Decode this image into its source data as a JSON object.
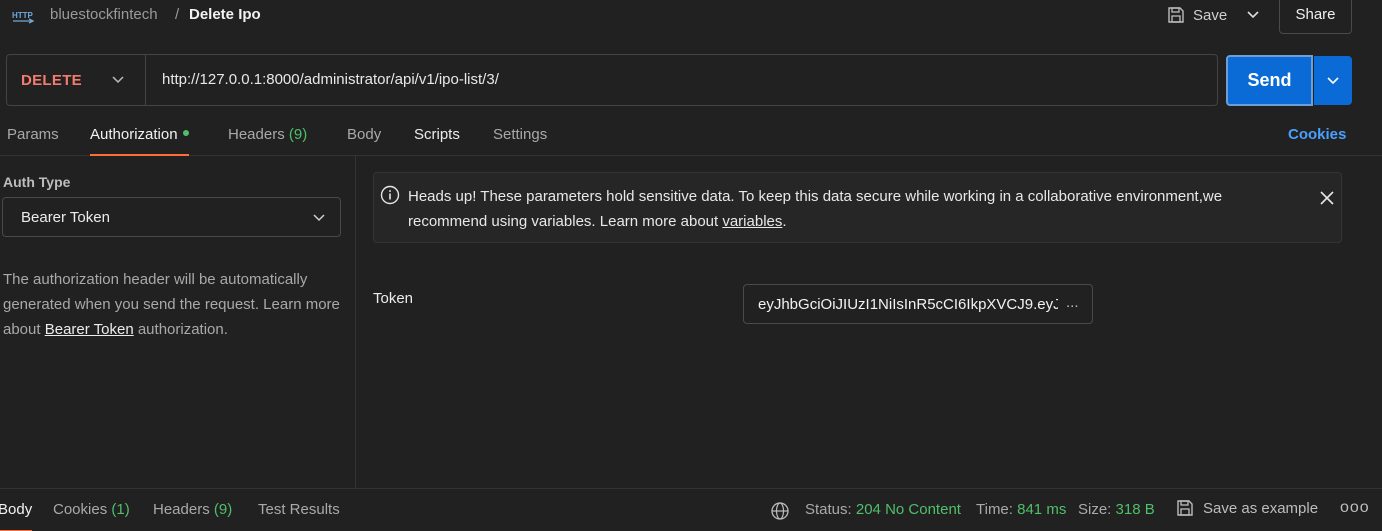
{
  "header": {
    "collection": "bluestockfintech",
    "separator": "/",
    "request_name": "Delete Ipo",
    "save_label": "Save",
    "share_label": "Share"
  },
  "request": {
    "method": "DELETE",
    "url": "http://127.0.0.1:8000/administrator/api/v1/ipo-list/3/",
    "send_label": "Send"
  },
  "tabs": [
    {
      "label": "Params"
    },
    {
      "label": "Authorization"
    },
    {
      "label": "Headers",
      "count": "(9)"
    },
    {
      "label": "Body"
    },
    {
      "label": "Scripts"
    },
    {
      "label": "Settings"
    }
  ],
  "cookies_label": "Cookies",
  "auth": {
    "type_label": "Auth Type",
    "type_value": "Bearer Token",
    "desc_part1": "The authorization header will be automatically generated when you send the request. Learn more about ",
    "desc_link": "Bearer Token",
    "desc_part2": " authorization."
  },
  "notice": {
    "text": "Heads up! These parameters hold sensitive data. To keep this data secure while working in a collaborative environment,we recommend using variables. Learn more about ",
    "link": "variables",
    "end": "."
  },
  "token": {
    "label": "Token",
    "value": "eyJhbGciOiJIUzI1NiIsInR5cCI6IkpXVCJ9.eyJ",
    "ellipsis": "..."
  },
  "response": {
    "tabs": [
      {
        "label": "Body"
      },
      {
        "label": "Cookies",
        "count": "(1)"
      },
      {
        "label": "Headers",
        "count": "(9)"
      },
      {
        "label": "Test Results"
      }
    ],
    "status_label": "Status:",
    "status_value": "204 No Content",
    "time_label": "Time:",
    "time_value": "841 ms",
    "size_label": "Size:",
    "size_value": "318 B",
    "save_example_label": "Save as example",
    "more": "ooo"
  },
  "colors": {
    "accent": "#ff6c37",
    "send": "#0b6bd6",
    "method": "#f27c6f",
    "success": "#4fbf6a",
    "link": "#4a9fff"
  }
}
